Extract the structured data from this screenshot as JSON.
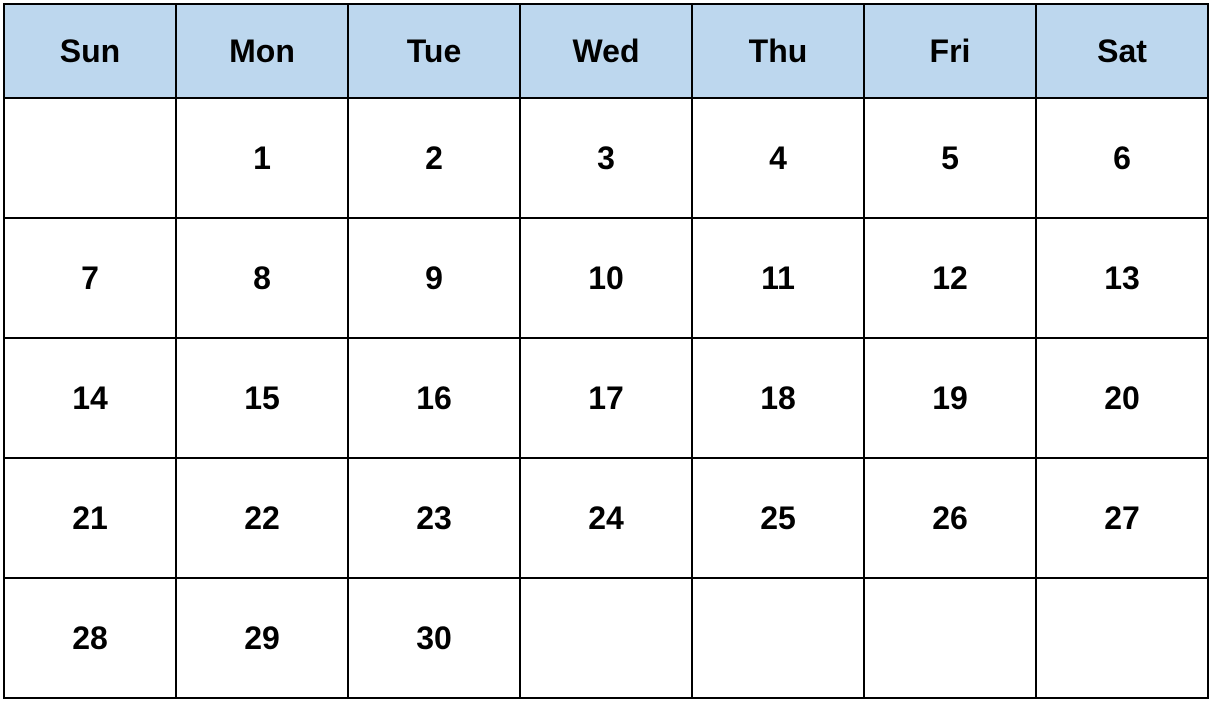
{
  "calendar": {
    "header_color": "#BDD7EE",
    "weekdays": [
      "Sun",
      "Mon",
      "Tue",
      "Wed",
      "Thu",
      "Fri",
      "Sat"
    ],
    "weeks": [
      [
        "",
        "1",
        "2",
        "3",
        "4",
        "5",
        "6"
      ],
      [
        "7",
        "8",
        "9",
        "10",
        "11",
        "12",
        "13"
      ],
      [
        "14",
        "15",
        "16",
        "17",
        "18",
        "19",
        "20"
      ],
      [
        "21",
        "22",
        "23",
        "24",
        "25",
        "26",
        "27"
      ],
      [
        "28",
        "29",
        "30",
        "",
        "",
        "",
        ""
      ]
    ]
  }
}
